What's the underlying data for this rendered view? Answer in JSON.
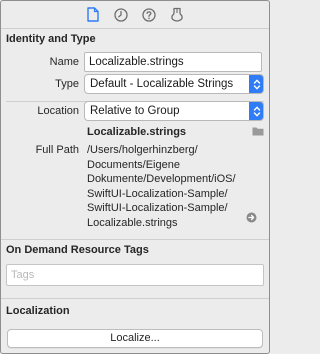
{
  "inspector_tabs": [
    {
      "icon": "file-icon",
      "selected": true
    },
    {
      "icon": "clock-icon",
      "selected": false
    },
    {
      "icon": "help-icon",
      "selected": false
    },
    {
      "icon": "shield-icon",
      "selected": false
    }
  ],
  "identity": {
    "section_title": "Identity and Type",
    "name_label": "Name",
    "name_value": "Localizable.strings",
    "type_label": "Type",
    "type_value": "Default - Localizable Strings",
    "location_label": "Location",
    "location_value": "Relative to Group",
    "filename": "Localizable.strings",
    "full_path_label": "Full Path",
    "full_path_lines": [
      "/Users/holgerhinzberg/",
      "Documents/Eigene",
      "Dokumente/Development/iOS/",
      "SwiftUI-Localization-Sample/",
      "SwiftUI-Localization-Sample/",
      "Localizable.strings"
    ]
  },
  "on_demand": {
    "section_title": "On Demand Resource Tags",
    "tags_placeholder": "Tags"
  },
  "localization": {
    "section_title": "Localization",
    "button_label": "Localize..."
  },
  "colors": {
    "accent": "#2f7cf6",
    "selected_tab": "#2f7cf6",
    "background": "#ececec"
  }
}
